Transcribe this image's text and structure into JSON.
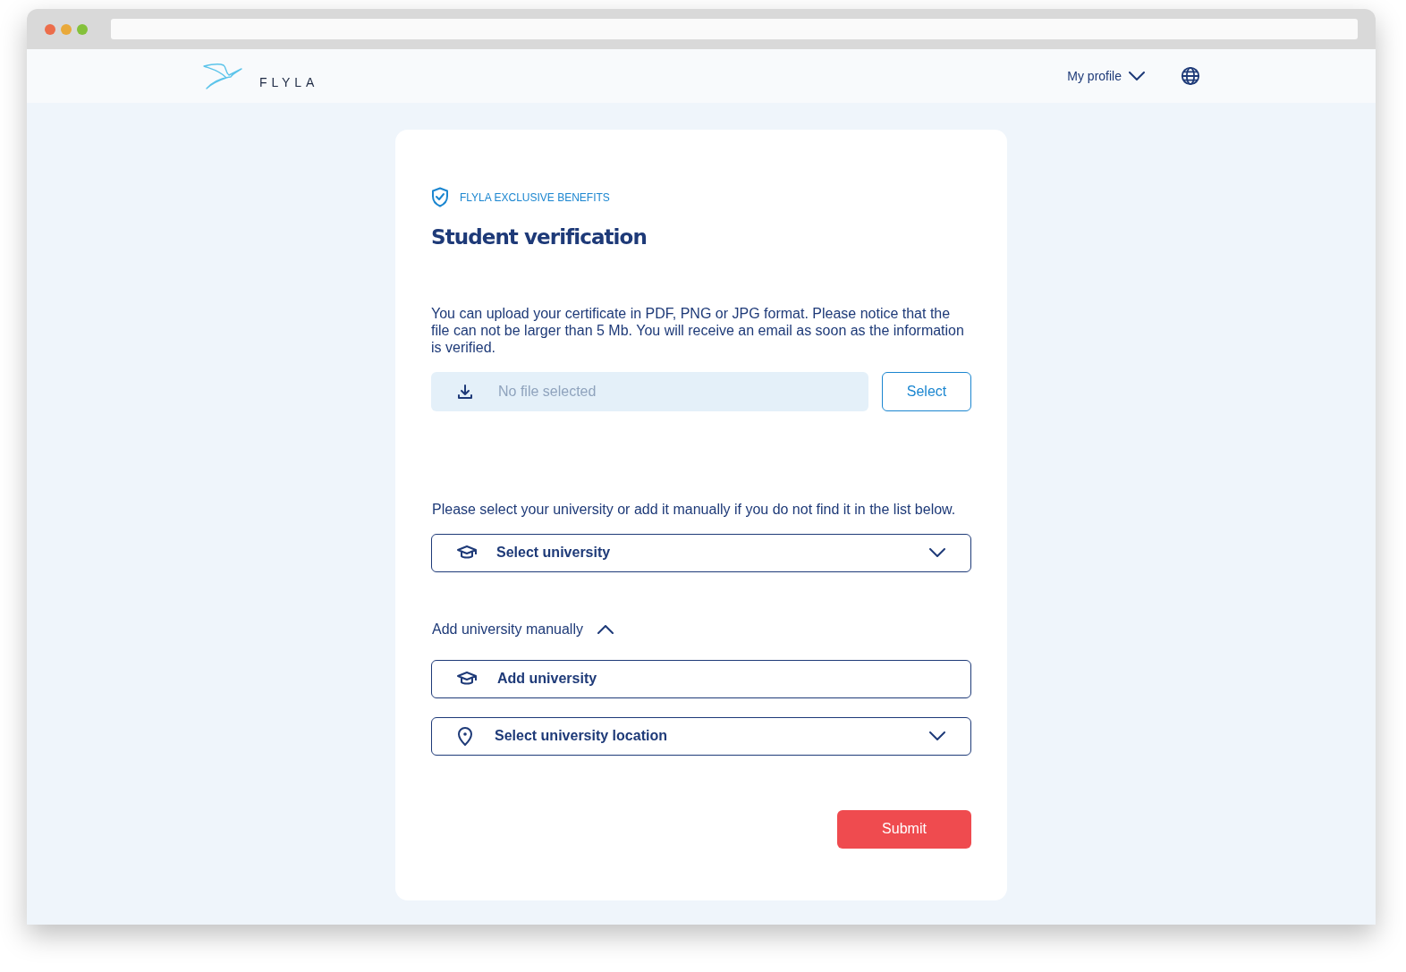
{
  "logo": {
    "text": "FLYLA"
  },
  "nav": {
    "profile": "My profile",
    "profile_expanded": false
  },
  "card": {
    "eyebrow": "FLYLA EXCLUSIVE BENEFITS",
    "title": "Student verification",
    "upload_text": "You can upload your certificate in PDF, PNG or JPG format. Please notice that the file can not be larger than 5 Mb. You will receive an email as soon as the information is verified.",
    "file_field": {
      "placeholder": "No file selected"
    },
    "select_button": "Select",
    "university_prompt": "Please select your university or add it manually if you do not find it in the list below.",
    "university_select": {
      "placeholder": "Select university",
      "expanded": false
    },
    "manual_toggle": {
      "label": "Add university manually",
      "expanded": true
    },
    "manual_fields": [
      {
        "kind": "input",
        "placeholder": "Add university"
      },
      {
        "kind": "select",
        "placeholder": "Select university location"
      }
    ],
    "submit": "Submit"
  }
}
